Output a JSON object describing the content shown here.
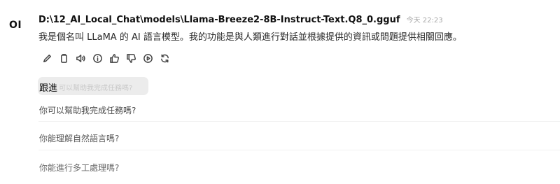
{
  "avatar": {
    "initials": "OI"
  },
  "message": {
    "model_name": "D:\\12_AI_Local_Chat\\models\\Llama-Breeze2-8B-Instruct-Text.Q8_0.gguf",
    "timestamp": "今天 22:23",
    "text": "我是個名叫 LLaMA 的 AI 語言模型。我的功能是與人類進行對話並根據提供的資訊或問題提供相關回應。"
  },
  "toolbar": {
    "icons": [
      "edit-icon",
      "copy-icon",
      "read-aloud-icon",
      "info-icon",
      "thumbs-up-icon",
      "thumbs-down-icon",
      "play-icon",
      "regenerate-icon"
    ]
  },
  "followup": {
    "label": "跟進",
    "ghost_text": "可以幫助我完成任務嗎?"
  },
  "suggestions": [
    "你可以幫助我完成任務嗎?",
    "你能理解自然語言嗎?",
    "你能進行多工處理嗎?"
  ]
}
